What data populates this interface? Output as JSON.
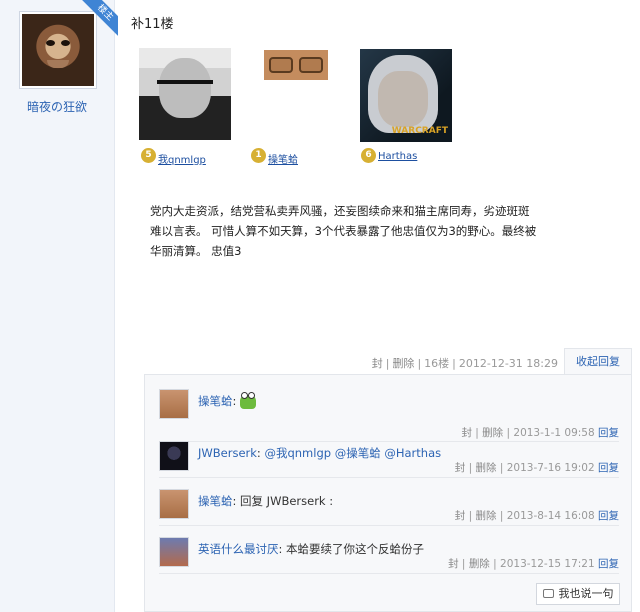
{
  "author": {
    "name": "暗夜の狂欲",
    "badge": "楼主"
  },
  "post": {
    "floor_title": "补11楼",
    "cards": [
      {
        "label": "我qnmlgp",
        "level": "5"
      },
      {
        "label": "操笔蛤",
        "level": "1"
      },
      {
        "label": "Harthas",
        "level": "6"
      }
    ],
    "card_logo": "WARCRAFT",
    "content": "党内大走资派，结党营私卖弄风骚，还妄图续命来和猫主席同寿，劣迹斑斑难以言表。 可惜人算不如天算，3个代表暴露了他忠值仅为3的野心。最终被华丽清算。 忠值3",
    "meta": {
      "block": "封",
      "delete": "删除",
      "floor": "16楼",
      "time": "2012-12-31 18:29",
      "collapse": "收起回复"
    }
  },
  "replies": [
    {
      "name": "操笔蛤",
      "sep": ": ",
      "text": "",
      "emoji": "frog-emoji",
      "block": "封",
      "delete": "删除",
      "time": "2013-1-1 09:58",
      "reply": "回复"
    },
    {
      "name": "JWBerserk",
      "sep": ": ",
      "mentions": [
        "@我qnmlgp",
        "@操笔蛤",
        "@Harthas"
      ],
      "block": "封",
      "delete": "删除",
      "time": "2013-7-16 19:02",
      "reply": "回复"
    },
    {
      "name": "操笔蛤",
      "sep": ": ",
      "text": "回复 JWBerserk :",
      "block": "封",
      "delete": "删除",
      "time": "2013-8-14 16:08",
      "reply": "回复"
    },
    {
      "name": "英语什么最讨厌",
      "sep": ": ",
      "text": "本蛤要续了你这个反蛤份子",
      "block": "封",
      "delete": "删除",
      "time": "2013-12-15 17:21",
      "reply": "回复"
    }
  ],
  "write_button": "我也说一句",
  "colors": {
    "link": "#2d64b3",
    "sidebar_bg": "#f2f5fa",
    "badge": "#3f84d4"
  }
}
